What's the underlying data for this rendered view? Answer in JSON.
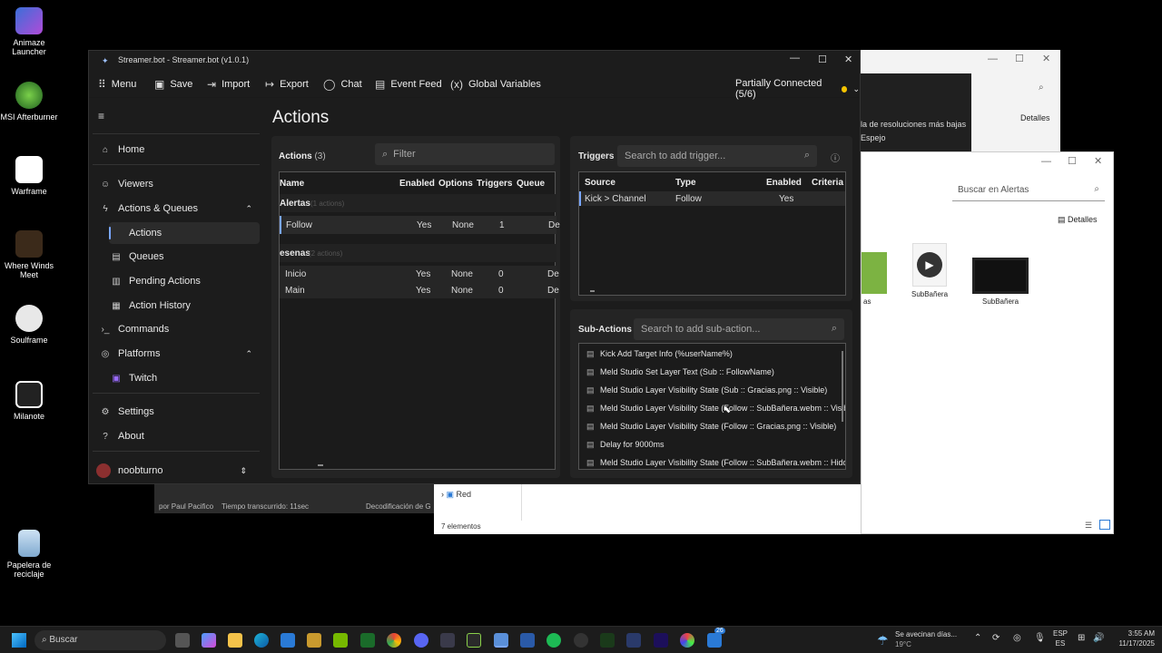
{
  "desktop": {
    "icons": [
      {
        "label": "Animaze Launcher"
      },
      {
        "label": "MSI Afterburner"
      },
      {
        "label": "Warframe"
      },
      {
        "label": "Where Winds Meet"
      },
      {
        "label": "Soulframe"
      },
      {
        "label": "Milanote"
      },
      {
        "label": "Papelera de reciclaje"
      }
    ]
  },
  "bg_window_1": {
    "text1": "la de resoluciones más bajas",
    "text2": "Espejo",
    "details": "Detalles"
  },
  "explorer": {
    "search_placeholder": "Buscar en Alertas",
    "details": "Detalles",
    "files": [
      {
        "name": "SubBañera",
        "kind": "audio"
      },
      {
        "name": "SubBañera",
        "kind": "video"
      }
    ],
    "partial_label": "as",
    "nav_item": "Red",
    "status": "7 elementos"
  },
  "under_window": {
    "author": "por Paul Pacifico",
    "elapsed": "Tiempo transcurrido: 11sec",
    "decoding": "Decodificación de G"
  },
  "app": {
    "title": "Streamer.bot - Streamer.bot (v1.0.1)",
    "toolbar": {
      "menu": "Menu",
      "save": "Save",
      "import": "Import",
      "export": "Export",
      "chat": "Chat",
      "event_feed": "Event Feed",
      "global_variables": "Global Variables",
      "connection": "Partially Connected (5/6)"
    },
    "sidebar": {
      "home": "Home",
      "viewers": "Viewers",
      "actions_queues": "Actions & Queues",
      "actions": "Actions",
      "queues": "Queues",
      "pending_actions": "Pending Actions",
      "action_history": "Action History",
      "commands": "Commands",
      "platforms": "Platforms",
      "twitch": "Twitch",
      "settings": "Settings",
      "about": "About",
      "user": "noobturno"
    },
    "page_title": "Actions",
    "actions_panel": {
      "title": "Actions",
      "count": "(3)",
      "filter_placeholder": "Filter",
      "columns": [
        "Name",
        "Enabled",
        "Options",
        "Triggers",
        "Queue"
      ],
      "groups": [
        {
          "name": "Alertas",
          "sub": "(1 actions)",
          "rows": [
            {
              "name": "Follow",
              "enabled": "Yes",
              "options": "None",
              "triggers": "1",
              "queue": "De"
            }
          ]
        },
        {
          "name": "esenas",
          "sub": "(2 actions)",
          "rows": [
            {
              "name": "Inicio",
              "enabled": "Yes",
              "options": "None",
              "triggers": "0",
              "queue": "De"
            },
            {
              "name": "Main",
              "enabled": "Yes",
              "options": "None",
              "triggers": "0",
              "queue": "De"
            }
          ]
        }
      ]
    },
    "triggers_panel": {
      "title": "Triggers",
      "search_placeholder": "Search to add trigger...",
      "columns": [
        "Source",
        "Type",
        "Enabled",
        "Criteria"
      ],
      "rows": [
        {
          "source": "Kick > Channel",
          "type": "Follow",
          "enabled": "Yes",
          "criteria": ""
        }
      ]
    },
    "subactions_panel": {
      "title": "Sub-Actions",
      "search_placeholder": "Search to add sub-action...",
      "items": [
        "Kick Add Target Info (%userName%)",
        "Meld Studio Set Layer Text (Sub :: FollowName)",
        "Meld Studio Layer Visibility State (Sub :: Gracias.png :: Visible)",
        "Meld Studio Layer Visibility State (Follow :: SubBañera.webm :: Visible)",
        "Meld Studio Layer Visibility State (Follow :: Gracias.png :: Visible)",
        "Delay for 9000ms",
        "Meld Studio Layer Visibility State (Follow :: SubBañera.webm :: Hidden)"
      ]
    }
  },
  "taskbar": {
    "search_placeholder": "Buscar",
    "weather_text": "Se avecinan días...",
    "temperature": "19°C",
    "lang1": "ESP",
    "lang2": "ES",
    "time": "3:55 AM",
    "date": "11/17/2025",
    "badge": "26"
  }
}
